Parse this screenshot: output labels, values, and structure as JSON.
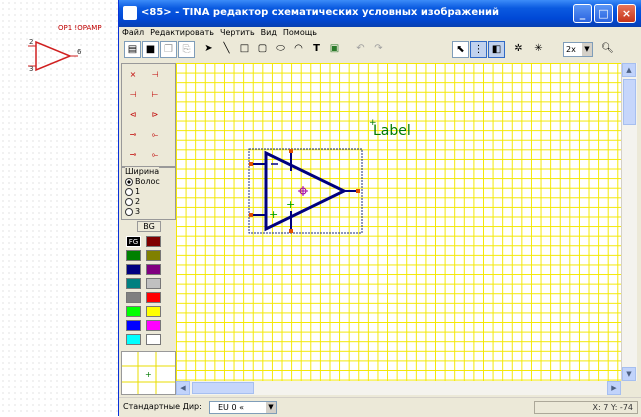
{
  "preview": {
    "label": "OP1 !OPAMP",
    "pins": [
      "2",
      "3",
      "6"
    ]
  },
  "window": {
    "title": "<85> - TINA редактор схематических условных изображений",
    "minimize": "_",
    "maximize": "□",
    "close": "×"
  },
  "menu": [
    "Файл",
    "Редактировать",
    "Чертить",
    "Вид",
    "Помощь"
  ],
  "toolbar": {
    "tools": [
      "new-icon",
      "save-icon",
      "copy-icon",
      "paste-icon",
      "select-arrow-icon",
      "line-icon",
      "rectangle-icon",
      "rounded-rect-icon",
      "ellipse-icon",
      "arc-icon",
      "text-icon",
      "image-icon",
      "undo-icon",
      "redo-icon",
      "pointer-mode-icon",
      "grid-icon",
      "frame-icon",
      "zoom-in-gear-icon",
      "zoom-out-gear-icon",
      "zoom-icon"
    ],
    "zoom_value": "2x"
  },
  "left_panel": {
    "width_group": {
      "title": "Ширина",
      "options": [
        "Волос",
        "1",
        "2",
        "3"
      ],
      "selected": "Волос"
    },
    "bg_button": "BG",
    "fg_label": "FG",
    "palette": [
      "#800000",
      "#008000",
      "#808000",
      "#000080",
      "#800080",
      "#008080",
      "#c0c0c0",
      "#808080",
      "#ff0000",
      "#00ff00",
      "#ffff00",
      "#0000ff",
      "#ff00ff",
      "#00ffff",
      "#ffffff"
    ]
  },
  "canvas": {
    "label_text": "Label",
    "grid_color": "#f3e800",
    "symbol_color": "#00007f"
  },
  "statusbar": {
    "direction_label": "Стандартные Дир:",
    "direction_value": "EU    0  «",
    "coords": "X: 7  Y: -74"
  }
}
